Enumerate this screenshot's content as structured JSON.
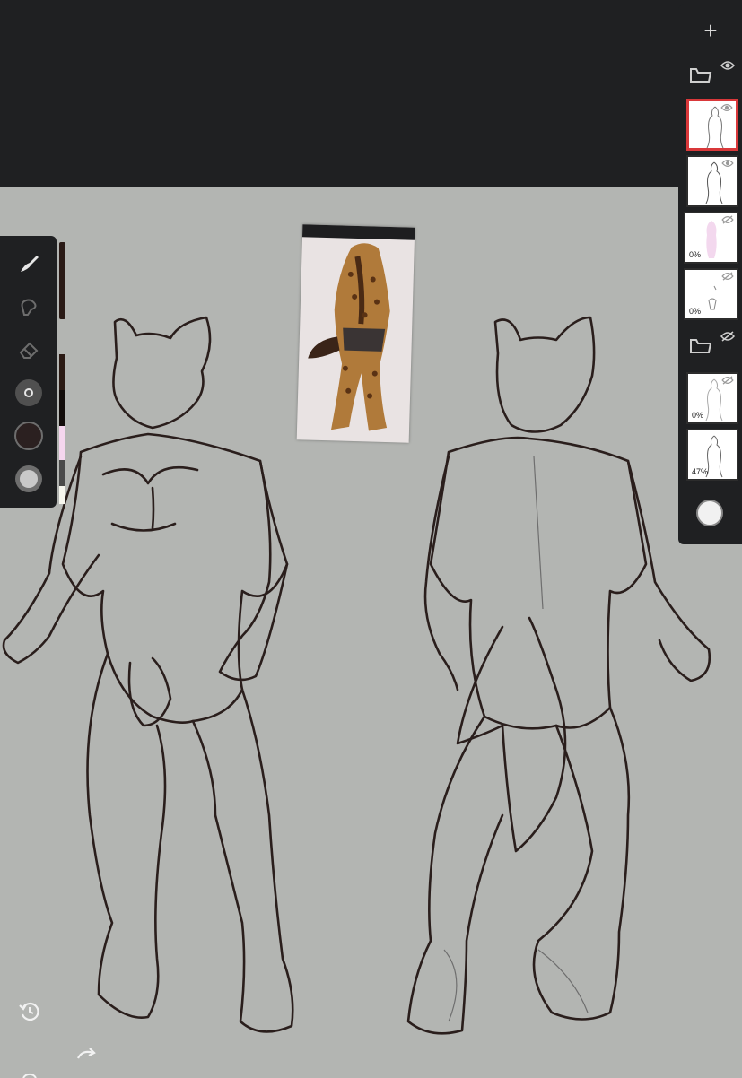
{
  "app": {
    "theme": {
      "panel": "#1f2022",
      "canvas": "#b3b5b2",
      "selection": "#d9383a",
      "line": "#2a1e1c"
    }
  },
  "toolbar": {
    "tools": [
      "brush-icon",
      "smudge-icon",
      "eraser-icon",
      "brush-size-icon",
      "primary-color-icon",
      "secondary-color-icon"
    ],
    "primary_color": "#2b2020",
    "swatches": [
      "#2b1a14",
      "#120c0a",
      "#f5d6ee",
      "#4a4a4a",
      "#f6f6ee"
    ]
  },
  "layers": {
    "add_label": "+",
    "items": [
      {
        "type": "group",
        "visible": true
      },
      {
        "type": "layer",
        "opacity": "",
        "visible": true,
        "selected": true
      },
      {
        "type": "layer",
        "opacity": "",
        "visible": true,
        "selected": false
      },
      {
        "type": "layer",
        "opacity": "0%",
        "visible": false,
        "selected": false
      },
      {
        "type": "layer",
        "opacity": "0%",
        "visible": false,
        "selected": false
      },
      {
        "type": "group",
        "visible": false
      },
      {
        "type": "layer",
        "opacity": "0%",
        "visible": false,
        "selected": false
      },
      {
        "type": "layer",
        "opacity": "47%",
        "visible": true,
        "selected": false
      }
    ],
    "color_button": "#f1f1f1"
  },
  "history": {
    "undo_icon": "undo-icon",
    "redo_icon": "redo-icon"
  }
}
